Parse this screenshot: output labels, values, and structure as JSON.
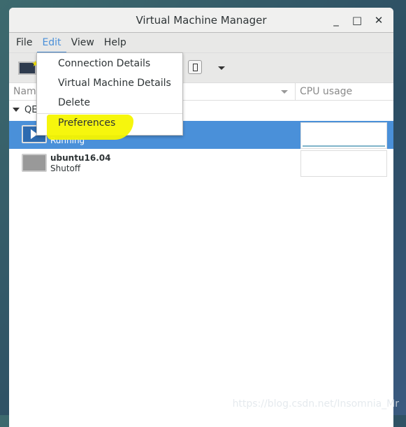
{
  "window": {
    "title": "Virtual Machine Manager",
    "min": "_",
    "max": "□",
    "close": "✕"
  },
  "menubar": [
    "File",
    "Edit",
    "View",
    "Help"
  ],
  "edit_menu": [
    "Connection Details",
    "Virtual Machine Details",
    "Delete",
    "Preferences"
  ],
  "table": {
    "col_name": "Name",
    "col_cpu": "CPU usage",
    "group": "QEMU/KVM",
    "vms": [
      {
        "name": "",
        "status": "Running"
      },
      {
        "name": "ubuntu16.04",
        "status": "Shutoff"
      }
    ]
  },
  "watermark": "https://blog.csdn.net/Insomnia_Mr",
  "colors": {
    "selection": "#4a90d9",
    "highlight": "#f5f500"
  }
}
